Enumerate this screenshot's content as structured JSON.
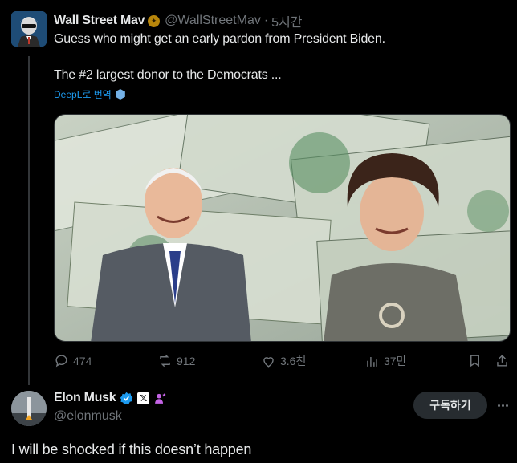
{
  "original_tweet": {
    "author_name": "Wall Street Mav",
    "author_handle": "@WallStreetMav",
    "separator": "·",
    "time": "5시간",
    "line1": "Guess who might get an early pardon from President Biden.",
    "line2": "The #2 largest donor to the Democrats ...",
    "translate_label": "DeepL로 번역"
  },
  "actions": {
    "replies": "474",
    "reposts": "912",
    "likes": "3.6천",
    "views": "37만"
  },
  "reply_tweet": {
    "author_name": "Elon Musk",
    "author_handle": "@elonmusk",
    "subscribe_label": "구독하기",
    "x_badge": "𝕏",
    "text": "I will be shocked if this doesn’t happen"
  },
  "colors": {
    "background": "#000000",
    "text": "#e7e9ea",
    "muted": "#71767b",
    "link": "#1d9bf0",
    "verified": "#1d9bf0",
    "affiliate": "#c564e6"
  }
}
